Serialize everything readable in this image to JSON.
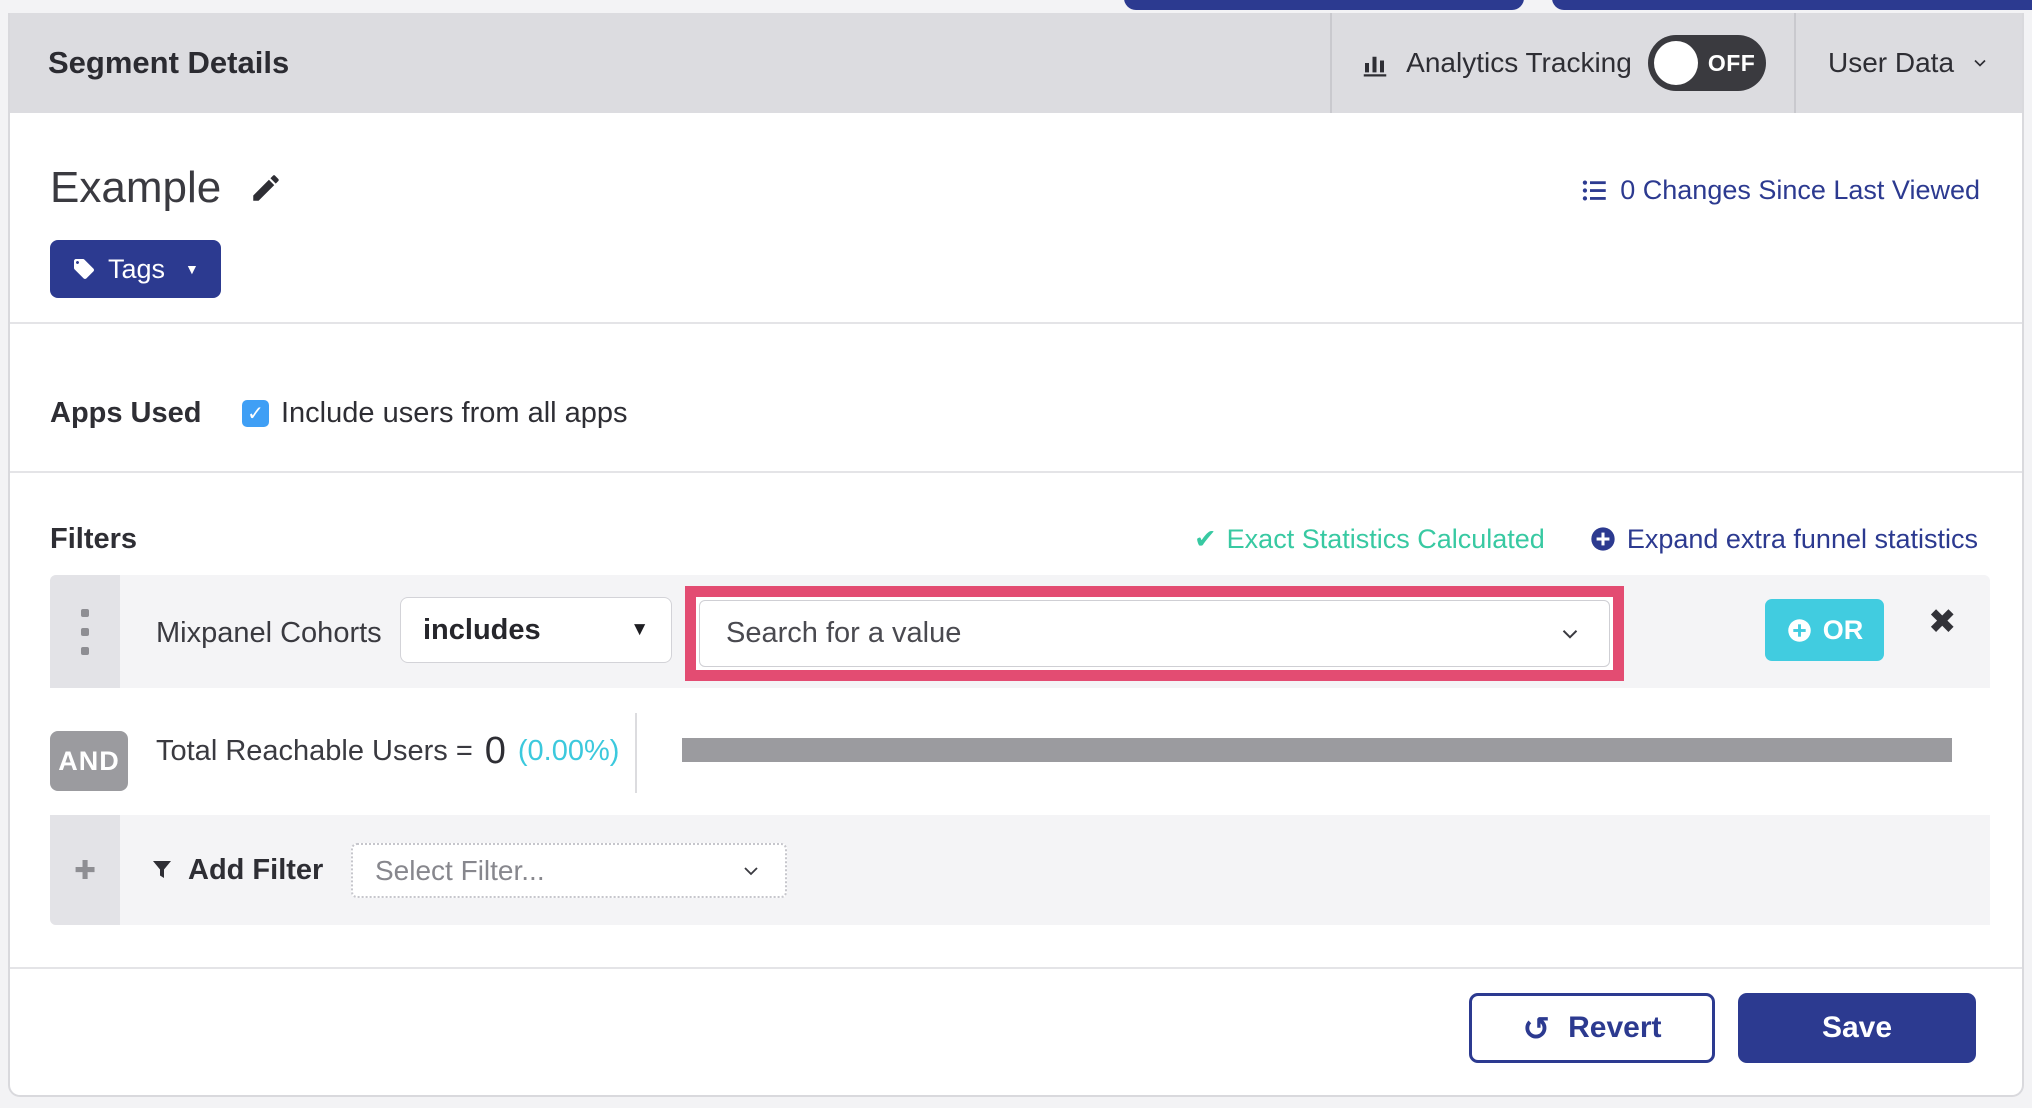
{
  "header": {
    "title": "Segment Details",
    "analytics_label": "Analytics Tracking",
    "toggle_state": "OFF",
    "user_data_label": "User Data"
  },
  "segment": {
    "name": "Example",
    "tags_label": "Tags",
    "changes_link": "0 Changes Since Last Viewed"
  },
  "apps_used": {
    "label": "Apps Used",
    "checkbox_label": "Include users from all apps",
    "checked": true,
    "checkmark": "✓"
  },
  "filters": {
    "heading": "Filters",
    "exact_stats": "Exact Statistics Calculated",
    "exact_stats_check": "✔",
    "expand_link": "Expand extra funnel statistics",
    "row": {
      "field": "Mixpanel Cohorts",
      "operator": "includes",
      "operator_caret": "▼",
      "value_placeholder": "Search for a value",
      "or_label": "OR",
      "remove_glyph": "✖"
    },
    "conjunction": "AND",
    "reach": {
      "label": "Total Reachable Users =",
      "value": "0",
      "percent": "(0.00%)"
    },
    "add_filter": {
      "plus_glyph": "✚",
      "label": "Add Filter",
      "placeholder": "Select Filter..."
    }
  },
  "tags_caret": "▼",
  "footer": {
    "revert": "Revert",
    "revert_icon": "↺",
    "save": "Save"
  },
  "colors": {
    "page-bg": "#f3f3f5",
    "indigo": "#2c3a90",
    "cyan": "#41cce0",
    "cyan-text": "#3cc9dd",
    "teal": "#38c9a2",
    "pink": "#e34c72",
    "checkbox-blue": "#3f9ff5",
    "badge-gray": "#9b9b9f",
    "header-gray": "#dcdce0",
    "row-gray": "#f4f4f6",
    "col-gray": "#e3e3e7",
    "toggle-dark": "#3a3a3f",
    "dark-text": "#2e2e34"
  }
}
